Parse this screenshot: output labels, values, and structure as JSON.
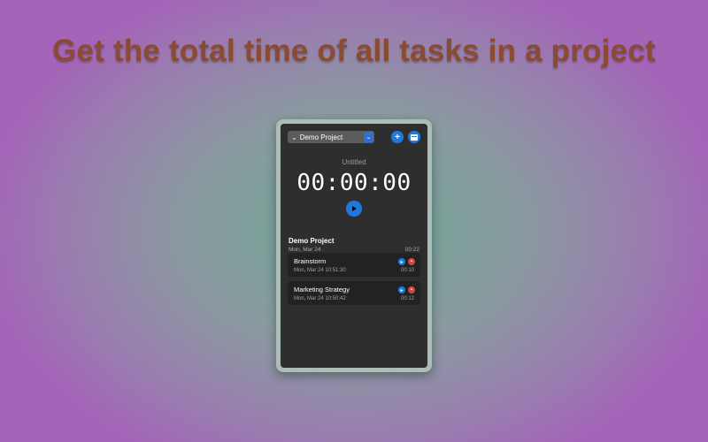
{
  "headline": "Get the total time of all tasks in a project",
  "toolbar": {
    "project_selected": "Demo Project",
    "add_icon": "plus-icon",
    "list_icon": "list-icon"
  },
  "timer": {
    "task_title": "Untitled",
    "elapsed": "00:00:00",
    "play_icon": "play-icon"
  },
  "project": {
    "name": "Demo Project",
    "date": "Mon, Mar 24",
    "total": "00:22",
    "tasks": [
      {
        "name": "Brainstorm",
        "timestamp": "Mon, Mar 24 10:51:30",
        "duration": "00:10"
      },
      {
        "name": "Marketing Strategy",
        "timestamp": "Mon, Mar 24 10:50:42",
        "duration": "00:12"
      }
    ]
  },
  "colors": {
    "accent": "#1f7ae0",
    "delete": "#d64545",
    "headline": "#8b4a32",
    "panel": "#2e2e2e"
  }
}
